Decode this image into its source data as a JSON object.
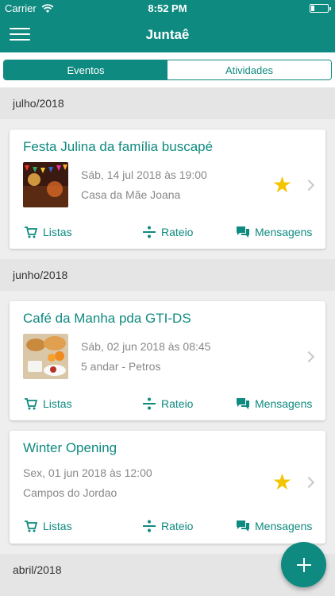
{
  "status_bar": {
    "carrier": "Carrier",
    "time": "8:52 PM"
  },
  "navbar": {
    "title": "Juntaê"
  },
  "segment": {
    "tabs": [
      "Eventos",
      "Atividades"
    ],
    "selected": "Eventos"
  },
  "sections": [
    {
      "label": "julho/2018"
    },
    {
      "label": "junho/2018"
    },
    {
      "label": "abril/2018"
    }
  ],
  "events": [
    {
      "title": "Festa Julina da família buscapé",
      "date": "Sáb, 14 jul 2018 às 19:00",
      "place": "Casa da Mãe Joana",
      "starred": true
    },
    {
      "title": "Café da Manha pda GTI-DS",
      "date": "Sáb, 02 jun 2018 às 08:45",
      "place": "5 andar - Petros",
      "starred": false
    },
    {
      "title": "Winter Opening",
      "date": "Sex, 01 jun 2018 às 12:00",
      "place": "Campos do Jordao",
      "starred": true
    }
  ],
  "actions": {
    "lists": "Listas",
    "split": "Rateio",
    "messages": "Mensagens"
  },
  "fab": {
    "icon": "plus-icon"
  },
  "colors": {
    "primary": "#0f8a80",
    "star": "#f3c400",
    "section_bg": "#e5e5e5"
  }
}
